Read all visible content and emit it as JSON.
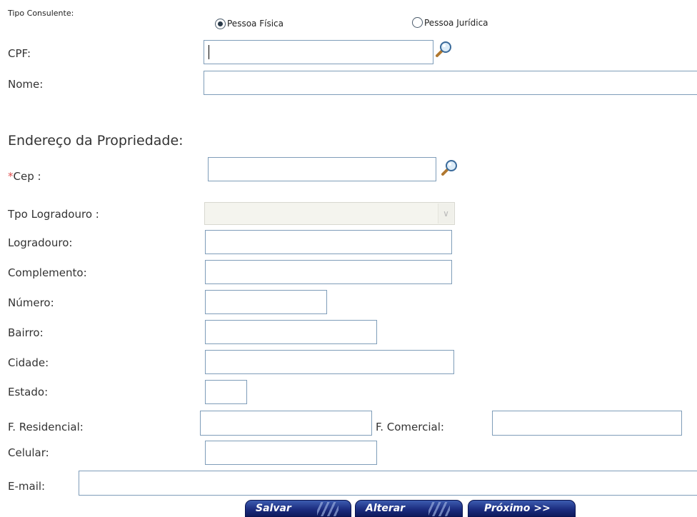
{
  "form": {
    "tipo_consulente": {
      "label": "Tipo Consulente:",
      "options": [
        {
          "label": "Pessoa Física",
          "checked": true
        },
        {
          "label": "Pessoa Jurídica",
          "checked": false
        }
      ]
    },
    "cpf": {
      "label": "CPF:",
      "value": ""
    },
    "nome": {
      "label": "Nome:",
      "value": ""
    }
  },
  "address": {
    "title": "Endereço da Propriedade:",
    "cep": {
      "required_mark": "*",
      "label": "Cep :",
      "value": ""
    },
    "tipo_logradouro": {
      "label": "Tpo Logradouro :",
      "value": ""
    },
    "logradouro": {
      "label": "Logradouro:",
      "value": ""
    },
    "complemento": {
      "label": "Complemento:",
      "value": ""
    },
    "numero": {
      "label": "Número:",
      "value": ""
    },
    "bairro": {
      "label": "Bairro:",
      "value": ""
    },
    "cidade": {
      "label": "Cidade:",
      "value": ""
    },
    "estado": {
      "label": "Estado:",
      "value": ""
    },
    "f_residencial": {
      "label": "F. Residencial:",
      "value": ""
    },
    "f_comercial": {
      "label": "F. Comercial:",
      "value": ""
    },
    "celular": {
      "label": "Celular:",
      "value": ""
    },
    "email": {
      "label": "E-mail:",
      "value": ""
    }
  },
  "buttons": {
    "salvar": "Salvar",
    "alterar": "Alterar",
    "proximo": "Próximo >>"
  },
  "colors": {
    "required": "#e05050",
    "button": "#1c2d80",
    "field_border": "#7f9db9"
  },
  "icons": {
    "search": "magnifier-icon"
  }
}
